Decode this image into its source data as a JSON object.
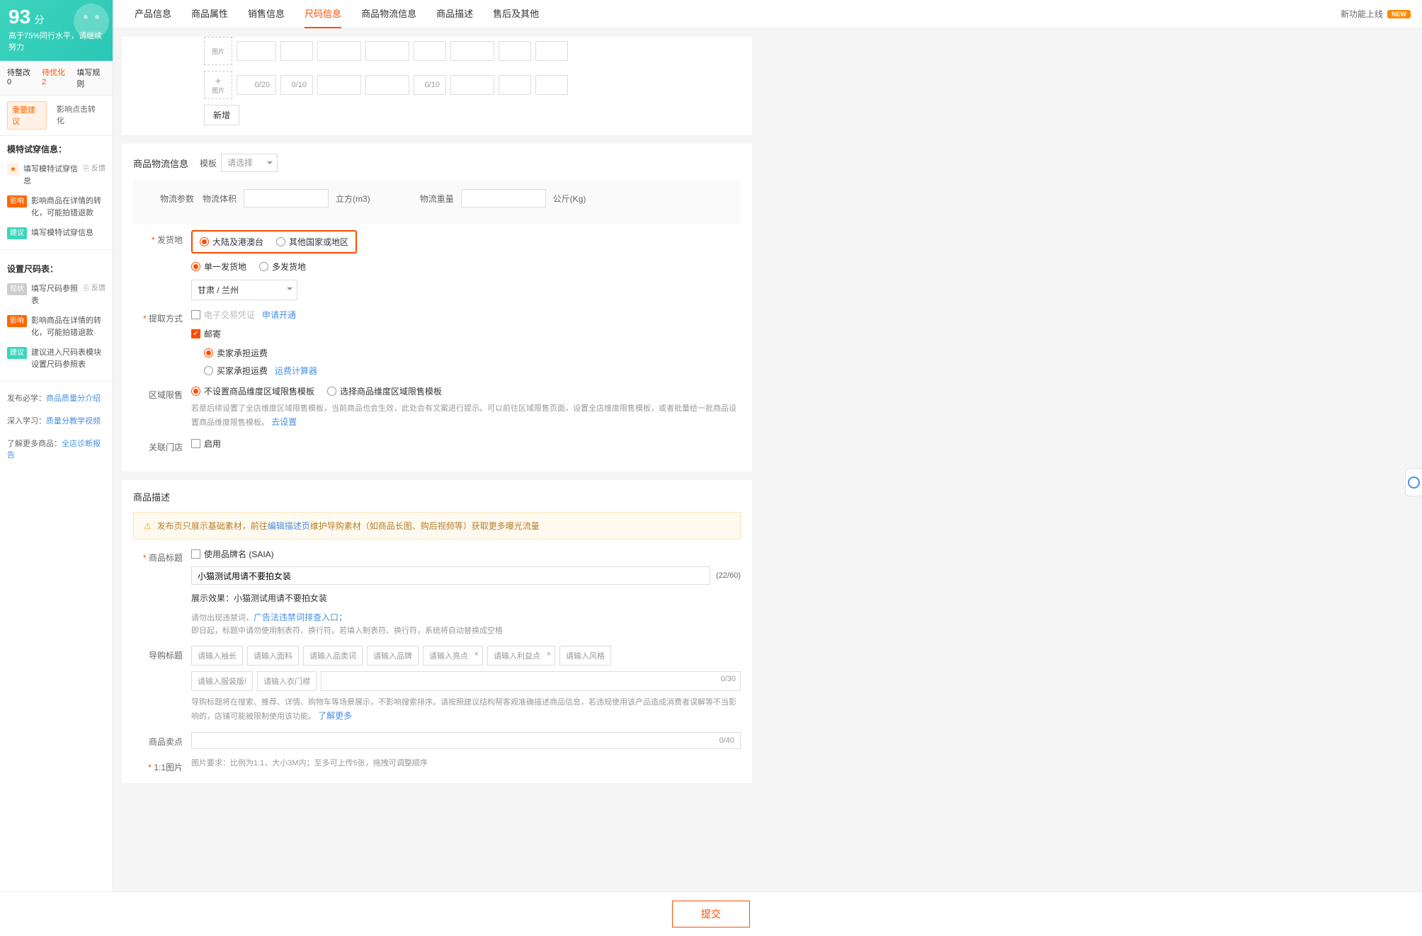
{
  "score": {
    "value": "93",
    "unit": "分",
    "text": "高于75%同行水平，请继续努力"
  },
  "sidebar_status": [
    "待整改 0",
    "待优化 2",
    "填写规则"
  ],
  "sidebar_pills": [
    "重要建议",
    "影响点击转化"
  ],
  "model_info": {
    "title": "模特试穿信息：",
    "items": [
      {
        "tag": "star",
        "tagLabel": "★",
        "text": "填写模特试穿信息",
        "feedback": "⎘ 反馈"
      },
      {
        "tag": "impact",
        "tagLabel": "影响",
        "text": "影响商品在详情的转化，可能拍错退款"
      },
      {
        "tag": "advice",
        "tagLabel": "建议",
        "text": "填写模特试穿信息"
      }
    ]
  },
  "size_table": {
    "title": "设置尺码表：",
    "items": [
      {
        "tag": "status",
        "tagLabel": "现状",
        "text": "填写尺码参照表",
        "feedback": "⎘ 反馈"
      },
      {
        "tag": "impact",
        "tagLabel": "影响",
        "text": "影响商品在详情的转化，可能拍错退款"
      },
      {
        "tag": "advice",
        "tagLabel": "建议",
        "text": "建议进入尺码表模块设置尺码参照表"
      }
    ]
  },
  "links": [
    {
      "label": "发布必学：",
      "text": "商品质量分介绍"
    },
    {
      "label": "深入学习：",
      "text": "质量分教学视频"
    },
    {
      "label": "了解更多商品：",
      "text": "全店诊断报告"
    }
  ],
  "tabs": [
    "产品信息",
    "商品属性",
    "销售信息",
    "尺码信息",
    "商品物流信息",
    "商品描述",
    "售后及其他"
  ],
  "active_tab": 3,
  "tabs_right": {
    "text": "新功能上线",
    "badge": "NEW"
  },
  "size_input_row": {
    "img_label": "图片",
    "cells": [
      "0/20",
      "0/10",
      "",
      "",
      "0/10",
      "",
      "",
      ""
    ]
  },
  "add_btn": "新增",
  "logistics": {
    "title": "商品物流信息",
    "template_label": "模板",
    "template_placeholder": "请选择",
    "params_label": "物流参数",
    "volume_label": "物流体积",
    "volume_unit": "立方(m3)",
    "weight_label": "物流重量",
    "weight_unit": "公斤(Kg)",
    "ship_label": "发货地",
    "ship_options": [
      "大陆及港澳台",
      "其他国家或地区"
    ],
    "single_multi": [
      "单一发货地",
      "多发货地"
    ],
    "location": "甘肃 / 兰州",
    "pickup_label": "提取方式",
    "ecert": "电子交易凭证",
    "apply_open": "申请开通",
    "post": "邮寄",
    "freight_options": [
      "卖家承担运费",
      "买家承担运费"
    ],
    "freight_calc": "运费计算器",
    "region_label": "区域限售",
    "region_options": [
      "不设置商品维度区域限售模板",
      "选择商品维度区域限售模板"
    ],
    "region_help": "若是后续设置了全店维度区域限售模板，当前商品也会生效，此处会有文案进行提示。可以前往区域限售页面，设置全店维度限售模板，或者批量给一批商品设置商品维度限售模板。",
    "to_setting": "去设置",
    "store_label": "关联门店",
    "enable": "启用"
  },
  "desc": {
    "title": "商品描述",
    "tip_pre": "发布页只展示基础素材，前往",
    "tip_link": "编辑描述页",
    "tip_post": "维护导购素材（如商品长图、购后视频等）获取更多曝光流量",
    "title_label": "商品标题",
    "use_brand": "使用品牌名 (SAIA)",
    "title_value": "小猫测试用请不要拍女装",
    "title_count": "(22/60)",
    "preview_label": "展示效果：",
    "preview_text": "小猫测试用请不要拍女装",
    "forbid_text": "请勿出现违禁词，",
    "forbid_link": "广告法违禁词排查入口；",
    "forbid_text2": "即日起，标题中请勿使用制表符、换行符。若填入制表符、换行符，系统将自动替换成空格",
    "guide_label": "导购标题",
    "guide_placeholders": [
      "请输入袖长",
      "请输入面料",
      "请输入品类词",
      "请输入品牌",
      "请输入亮点",
      "请输入利益点",
      "请输入风格"
    ],
    "guide_row2": [
      "请输入服装版!",
      "请输入衣门襟"
    ],
    "guide_count": "0/30",
    "guide_help": "导购标题将在搜索、推荐、详情、购物车等场景展示，不影响搜索排序。请按照建议结构帮客观准确描述商品信息，若违规使用该产品造成消费者误解等不当影响的，店铺可能被限制使用该功能。",
    "learn_more": "了解更多",
    "sellpoint_label": "商品卖点",
    "sellpoint_count": "0/40",
    "img11_label": "1:1图片",
    "img11_help": "图片要求：比例为1:1，大小3M内；至多可上传5张，拖拽可调整顺序"
  },
  "submit": "提交",
  "fb_icon": "⎘"
}
